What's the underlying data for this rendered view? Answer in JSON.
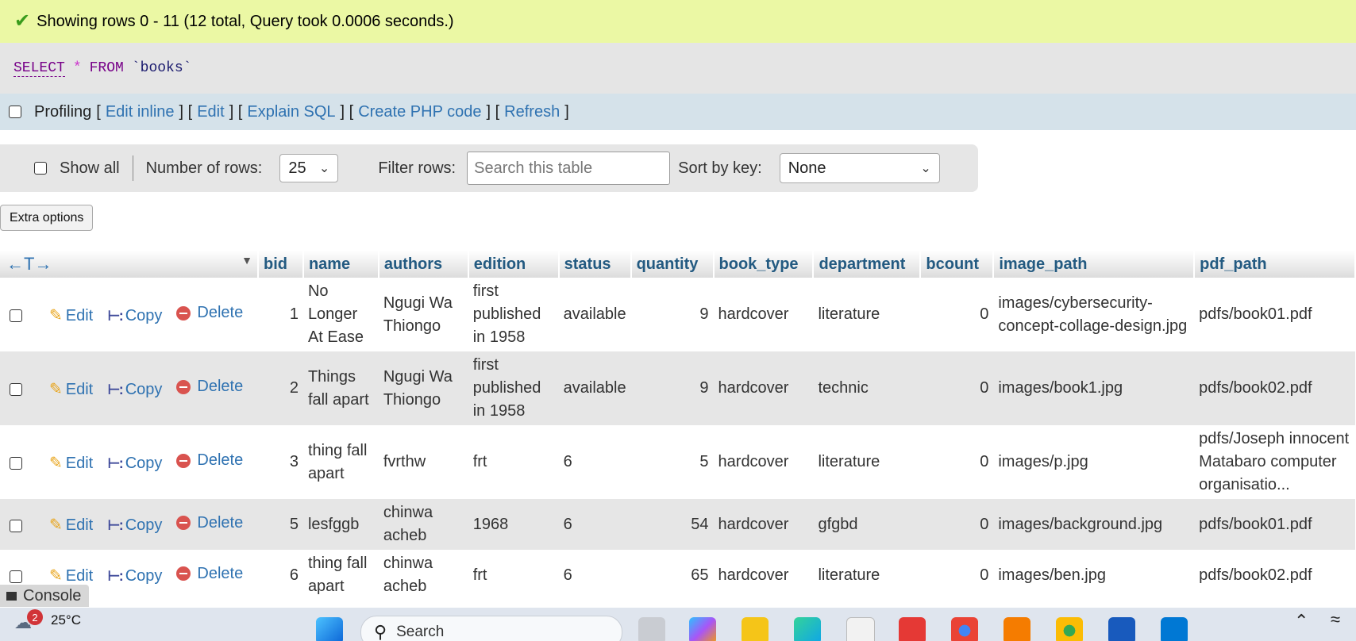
{
  "success": {
    "message": "Showing rows 0 - 11 (12 total, Query took 0.0006 seconds.)"
  },
  "sql": {
    "select": "SELECT",
    "star": "*",
    "from": "FROM",
    "table": "`books`"
  },
  "profiling": {
    "label": "Profiling",
    "links": [
      "Edit inline",
      "Edit",
      "Explain SQL",
      "Create PHP code",
      "Refresh"
    ]
  },
  "navigation": {
    "show_all": "Show all",
    "rows_label": "Number of rows:",
    "rows_value": "25",
    "filter_label": "Filter rows:",
    "filter_placeholder": "Search this table",
    "sort_label": "Sort by key:",
    "sort_value": "None"
  },
  "extra_options": "Extra options",
  "table": {
    "arrows": "←T→",
    "columns": [
      "bid",
      "name",
      "authors",
      "edition",
      "status",
      "quantity",
      "book_type",
      "department",
      "bcount",
      "image_path",
      "pdf_path"
    ],
    "action_labels": {
      "edit": "Edit",
      "copy": "Copy",
      "delete": "Delete"
    },
    "rows": [
      {
        "bid": "1",
        "name": "No Longer At Ease",
        "authors": "Ngugi Wa Thiongo",
        "edition": "first published in 1958",
        "status": "available",
        "quantity": "9",
        "book_type": "hardcover",
        "department": "literature",
        "bcount": "0",
        "image_path": "images/cybersecurity-concept-collage-design.jpg",
        "pdf_path": "pdfs/book01.pdf"
      },
      {
        "bid": "2",
        "name": "Things fall apart",
        "authors": "Ngugi Wa Thiongo",
        "edition": "first published in 1958",
        "status": "available",
        "quantity": "9",
        "book_type": "hardcover",
        "department": "technic",
        "bcount": "0",
        "image_path": "images/book1.jpg",
        "pdf_path": "pdfs/book02.pdf"
      },
      {
        "bid": "3",
        "name": "thing fall apart",
        "authors": "fvrthw",
        "edition": "frt",
        "status": "6",
        "quantity": "5",
        "book_type": "hardcover",
        "department": "literature",
        "bcount": "0",
        "image_path": "images/p.jpg",
        "pdf_path": "pdfs/Joseph innocent Matabaro computer organisatio..."
      },
      {
        "bid": "5",
        "name": "lesfggb",
        "authors": "chinwa acheb",
        "edition": "1968",
        "status": "6",
        "quantity": "54",
        "book_type": "hardcover",
        "department": "gfgbd",
        "bcount": "0",
        "image_path": "images/background.jpg",
        "pdf_path": "pdfs/book01.pdf"
      },
      {
        "bid": "6",
        "name": "thing fall apart",
        "authors": "chinwa acheb",
        "edition": "frt",
        "status": "6",
        "quantity": "65",
        "book_type": "hardcover",
        "department": "literature",
        "bcount": "0",
        "image_path": "images/ben.jpg",
        "pdf_path": "pdfs/book02.pdf"
      }
    ]
  },
  "console": {
    "label": "Console"
  },
  "taskbar": {
    "notification_count": "2",
    "temperature": "25°C",
    "search_label": "Search",
    "apps": [
      "start-icon",
      "search-icon",
      "task-view-icon",
      "copilot-icon",
      "file-explorer-icon",
      "edge-icon",
      "store-icon",
      "wps-icon",
      "chrome-icon",
      "xampp-icon",
      "chrome-profile-icon",
      "word-icon",
      "vscode-icon"
    ]
  }
}
